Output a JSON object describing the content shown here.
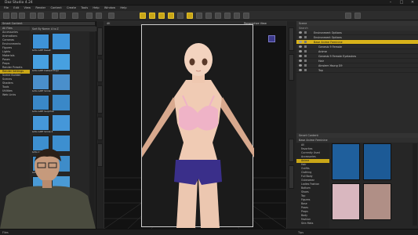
{
  "titlebar": {
    "title": "Daz Studio 4.24",
    "min": "–",
    "max": "□",
    "close": "✕"
  },
  "menubar": {
    "items": [
      "File",
      "Edit",
      "View",
      "Render",
      "Content",
      "Create",
      "Tools",
      "Help",
      "Window",
      "Help"
    ]
  },
  "left": {
    "tabs": {
      "smart_content": "Smart Content"
    },
    "tree": {
      "header": "All Files",
      "rows": [
        "Accessories",
        "Animations",
        "Cameras",
        "Environments",
        "Figures",
        "Lights",
        "Materials",
        "Poses",
        "Props",
        "Render Presets",
        "Render Settings",
        "Scene Builder",
        "Scenes",
        "Shaders",
        "Tools",
        "Utilities",
        "Web Links"
      ]
    },
    "filter": {
      "label": "Sort By Name: A to Z"
    },
    "thumbs": [
      {
        "label": "G3G Gl8F Reset",
        "color": "#3e93d8"
      },
      {
        "label": "G3G Gl8F Default Expr",
        "color": "#47a0e0"
      },
      {
        "label": "G3G Gl8F Smile",
        "color": "#4a8fcb"
      },
      {
        "label": "G3G Gl8F Surprise",
        "color": "#3a88c8"
      },
      {
        "label": "G3G Gl8F Smile 2",
        "color": "#4597d9"
      },
      {
        "label": "G3G Gl8F Blink",
        "color": "#3d8fd0"
      },
      {
        "label": "G3G Gl8F Frown",
        "color": "#3e8cc9"
      },
      {
        "label": "G3G Gl8F Talk",
        "color": "#4a9ad5"
      },
      {
        "label": "G3G Gl8F Expression",
        "color": "#4493d4"
      }
    ]
  },
  "viewport": {
    "label": "Perspective View",
    "hint": "4K"
  },
  "scene": {
    "header": "Scene",
    "filter": "Search",
    "rows": [
      "Environment Options",
      "Environment Options",
      "Base Anime Feminine",
      "Genesis 9 Female",
      "Anime",
      "Genesis 9 Female Eyelashes",
      "Hair",
      "Ainsiem Young G9",
      "Top"
    ],
    "selected": 2
  },
  "content": {
    "header": "Smart Content",
    "breadcrumb": "Base Anime Feminine",
    "list": [
      "All",
      "Favorites",
      "Currently Used",
      "Accessories",
      "Anime",
      "Hair",
      "Outfits",
      "Clothing",
      "Full Body",
      "Outerwear",
      "Ladies Fashion",
      "Bottom",
      "Shoes",
      "Top",
      "Figures",
      "Base",
      "Poses",
      "Props",
      "Body",
      "Fashion",
      "Skin Mats"
    ],
    "selected": 4
  },
  "status": {
    "left": "Files",
    "right": "Tips"
  }
}
